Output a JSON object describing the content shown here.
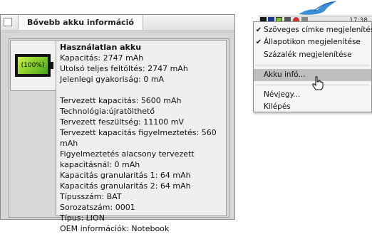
{
  "window": {
    "title": "Bővebb akku információ",
    "battery_percent": 1.0,
    "battery_label": "(100%)",
    "battery_fill_color": "#8ed12d",
    "lines": [
      "Használatlan akku",
      "Kapacitás: 2747 mAh",
      "Utolsó teljes feltöltés: 2747 mAh",
      "Jelenlegi gyakoriság: 0 mA",
      "",
      "Tervezett kapacitás: 5600 mAh",
      "Technológia:újratölthető",
      "Tervezett feszültség: 11100 mV",
      "Tervezett kapacitás figyelmeztetés: 560 mAh",
      "Figyelmeztetés alacsony tervezett kapacitásnál: 0 mAh",
      "Kapacitás granularitás 1: 64 mAh",
      "Kapacitás granularitás 2: 64 mAh",
      "Típusszám: BAT",
      "Sorozatszám: 0001",
      "Típus: LION",
      "OEM információk: Notebook"
    ]
  },
  "tray": {
    "clock": "17:38",
    "highlight_color": "#bfbfbf"
  },
  "menu": {
    "items": [
      {
        "label": "Szöveges címke megjelenítése",
        "checked": true,
        "check": "✔"
      },
      {
        "label": "Állapotikon megjelenítése",
        "checked": true,
        "check": "✔"
      },
      {
        "label": "Százalék megjelenítése",
        "checked": false,
        "check": ""
      },
      {
        "label": "Akku infó...",
        "checked": false,
        "check": "",
        "highlighted": true
      },
      {
        "label": "Névjegy...",
        "checked": false,
        "check": ""
      },
      {
        "label": "Kilépés",
        "checked": false,
        "check": ""
      }
    ]
  }
}
